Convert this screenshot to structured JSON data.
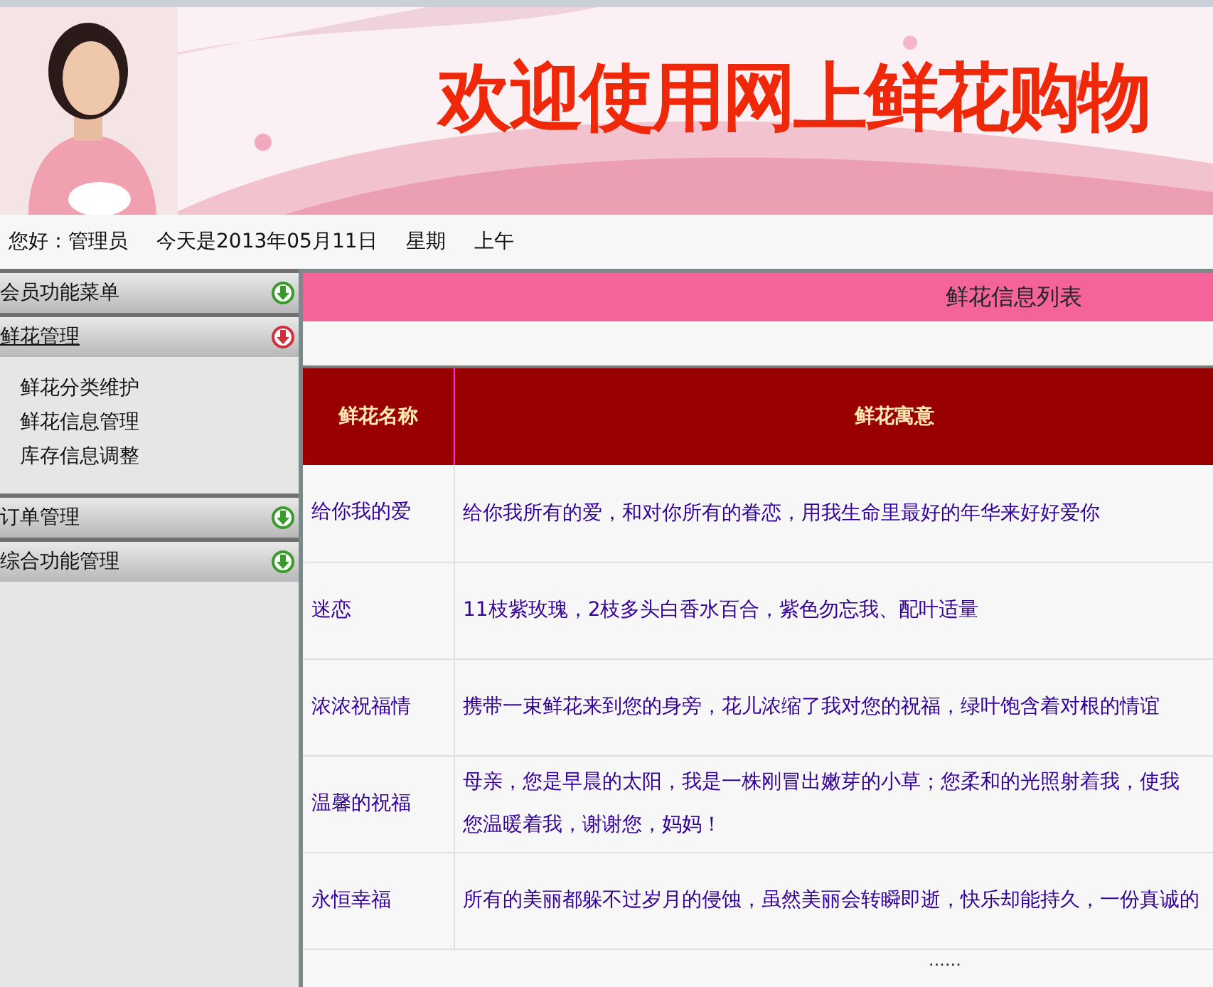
{
  "banner": {
    "title": "欢迎使用网上鲜花购物",
    "kind": "picture"
  },
  "greeting": {
    "user": "您好：管理员",
    "date": "今天是2013年05月11日",
    "weekday": "星期",
    "period": "上午"
  },
  "sidebar": {
    "menus": [
      {
        "label": "会员功能菜单",
        "expanded": false
      },
      {
        "label": "鲜花管理",
        "expanded": true,
        "children": [
          {
            "label": "鲜花分类维护"
          },
          {
            "label": "鲜花信息管理"
          },
          {
            "label": "库存信息调整"
          }
        ]
      },
      {
        "label": "订单管理",
        "expanded": false
      },
      {
        "label": "综合功能管理",
        "expanded": false
      }
    ]
  },
  "content": {
    "title": "鲜花信息列表",
    "table": {
      "columns": [
        "鲜花名称",
        "鲜花寓意"
      ],
      "rows": [
        {
          "name": "给你我的爱",
          "meaning": [
            "给你我所有的爱，和对你所有的眷恋，用我生命里最好的年华来好好爱你"
          ]
        },
        {
          "name": "迷恋",
          "meaning": [
            "11枝紫玫瑰，2枝多头白香水百合，紫色勿忘我、配叶适量"
          ]
        },
        {
          "name": "浓浓祝福情",
          "meaning": [
            "携带一束鲜花来到您的身旁，花儿浓缩了我对您的祝福，绿叶饱含着对根的情谊"
          ]
        },
        {
          "name": "温馨的祝福",
          "meaning": [
            "母亲，您是早晨的太阳，我是一株刚冒出嫩芽的小草；您柔和的光照射着我，使我",
            "您温暖着我，谢谢您，妈妈！"
          ]
        },
        {
          "name": "永恒幸福",
          "meaning": [
            "所有的美丽都躲不过岁月的侵蚀，虽然美丽会转瞬即逝，快乐却能持久，一份真诚的"
          ]
        }
      ]
    },
    "footer": "......"
  }
}
